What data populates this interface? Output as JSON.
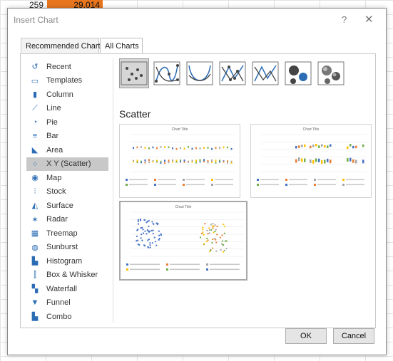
{
  "sheet": {
    "cell_a": "259",
    "cell_b": "29.014"
  },
  "dialog": {
    "title": "Insert Chart",
    "help_glyph": "?",
    "close_glyph": "✕",
    "tabs": [
      {
        "label": "Recommended Charts"
      },
      {
        "label": "All Charts"
      }
    ],
    "sidebar": [
      {
        "label": "Recent",
        "icon": "recent-icon",
        "glyph": "↺"
      },
      {
        "label": "Templates",
        "icon": "templates-icon",
        "glyph": "▭"
      },
      {
        "label": "Column",
        "icon": "column-chart-icon",
        "glyph": "▮"
      },
      {
        "label": "Line",
        "icon": "line-chart-icon",
        "glyph": "⟋"
      },
      {
        "label": "Pie",
        "icon": "pie-chart-icon",
        "glyph": "◔"
      },
      {
        "label": "Bar",
        "icon": "bar-chart-icon",
        "glyph": "≡"
      },
      {
        "label": "Area",
        "icon": "area-chart-icon",
        "glyph": "◣"
      },
      {
        "label": "X Y (Scatter)",
        "icon": "scatter-chart-icon",
        "glyph": "⁘"
      },
      {
        "label": "Map",
        "icon": "map-chart-icon",
        "glyph": "◉"
      },
      {
        "label": "Stock",
        "icon": "stock-chart-icon",
        "glyph": "⫶"
      },
      {
        "label": "Surface",
        "icon": "surface-chart-icon",
        "glyph": "◭"
      },
      {
        "label": "Radar",
        "icon": "radar-chart-icon",
        "glyph": "✶"
      },
      {
        "label": "Treemap",
        "icon": "treemap-chart-icon",
        "glyph": "▦"
      },
      {
        "label": "Sunburst",
        "icon": "sunburst-chart-icon",
        "glyph": "◍"
      },
      {
        "label": "Histogram",
        "icon": "histogram-chart-icon",
        "glyph": "▙"
      },
      {
        "label": "Box & Whisker",
        "icon": "box-whisker-chart-icon",
        "glyph": "⫿"
      },
      {
        "label": "Waterfall",
        "icon": "waterfall-chart-icon",
        "glyph": "▚"
      },
      {
        "label": "Funnel",
        "icon": "funnel-chart-icon",
        "glyph": "▼"
      },
      {
        "label": "Combo",
        "icon": "combo-chart-icon",
        "glyph": "▙"
      }
    ],
    "selected_category": "X Y (Scatter)",
    "subtypes": [
      {
        "icon": "scatter-icon",
        "selected": true
      },
      {
        "icon": "scatter-smooth-lines-markers-icon",
        "selected": false
      },
      {
        "icon": "scatter-smooth-lines-icon",
        "selected": false
      },
      {
        "icon": "scatter-straight-lines-markers-icon",
        "selected": false
      },
      {
        "icon": "scatter-straight-lines-icon",
        "selected": false
      },
      {
        "icon": "bubble-icon",
        "selected": false
      },
      {
        "icon": "3d-bubble-icon",
        "selected": false
      }
    ],
    "section_title": "Scatter",
    "previews": [
      {
        "title": "Chart Title"
      },
      {
        "title": "Chart Title"
      },
      {
        "title": "Chart Title"
      }
    ],
    "buttons": {
      "ok": "OK",
      "cancel": "Cancel"
    },
    "colors": {
      "accent_orange": "#e8761e",
      "selection_gray": "#c8c8c8",
      "series_blue": "#4472c4",
      "series_orange": "#ed7d31",
      "series_gray": "#a5a5a5",
      "series_yellow": "#ffc000",
      "series_green": "#70ad47"
    }
  }
}
